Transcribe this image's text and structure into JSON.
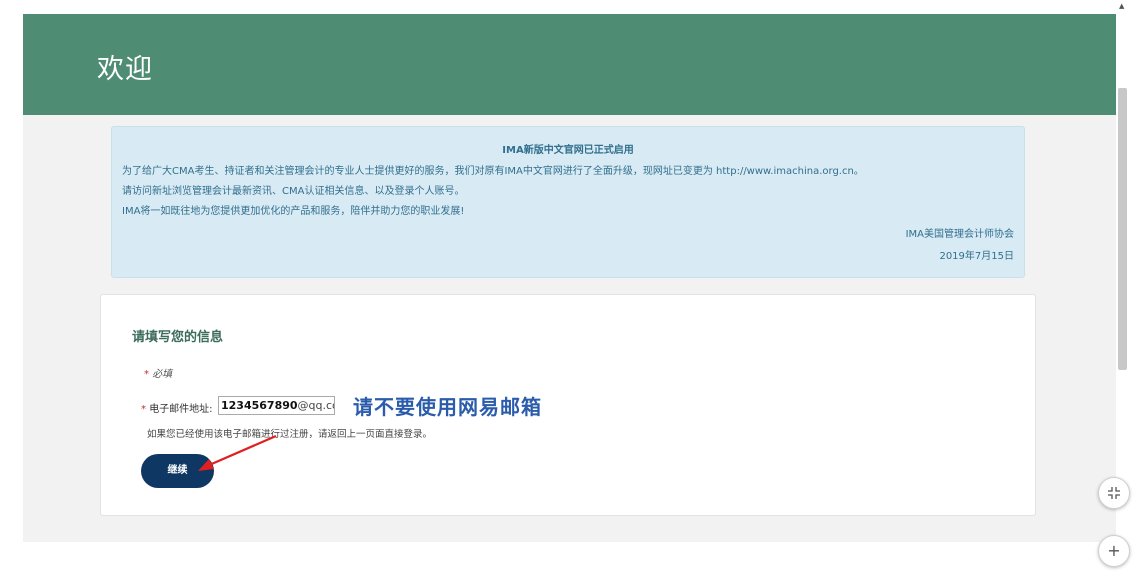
{
  "header": {
    "title": "欢迎"
  },
  "notice": {
    "title": "IMA新版中文官网已正式启用",
    "line1": "为了给广大CMA考生、持证者和关注管理会计的专业人士提供更好的服务，我们对原有IMA中文官网进行了全面升级，现网址已变更为 http://www.imachina.org.cn。",
    "line2": "请访问新址浏览管理会计最新资讯、CMA认证相关信息、以及登录个人账号。",
    "line3": "IMA将一如既往地为您提供更加优化的产品和服务，陪伴并助力您的职业发展!",
    "signature": "IMA美国管理会计师协会",
    "date": "2019年7月15日"
  },
  "form": {
    "heading": "请填写您的信息",
    "required_star": "*",
    "required_label": "必填",
    "email_label": "电子邮件地址:",
    "email_value_bold": "1234567890",
    "email_value_domain": "@qq.com",
    "warning": "请不要使用网易邮箱",
    "help_text": "如果您已经使用该电子邮箱进行过注册，请返回上一页面直接登录。",
    "continue_label": "继续"
  },
  "controls": {
    "collapse_icon": "collapse-icon",
    "zoom_in_icon": "plus-icon",
    "zoom_in_symbol": "+"
  },
  "colors": {
    "header_bg": "#4e8d74",
    "button_bg": "#0f3764",
    "warning_text": "#2a5cab",
    "arrow": "#e02020"
  }
}
